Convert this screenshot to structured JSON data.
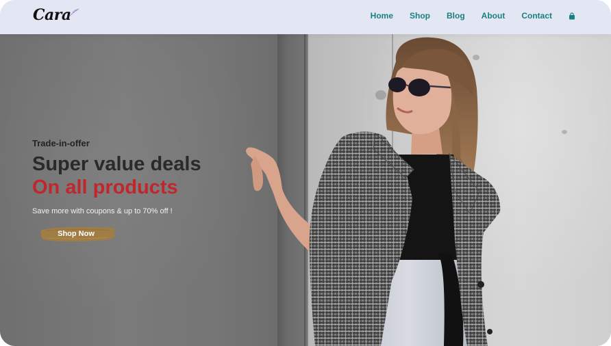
{
  "header": {
    "logo_text": "Cara",
    "nav": [
      {
        "label": "Home"
      },
      {
        "label": "Shop"
      },
      {
        "label": "Blog"
      },
      {
        "label": "About"
      },
      {
        "label": "Contact"
      }
    ],
    "cart_icon": "shopping-bag-icon",
    "nav_color": "#1a7f80",
    "background": "#e3e6f3"
  },
  "hero": {
    "subtitle": "Trade-in-offer",
    "headline_line1": "Super value deals",
    "headline_line2": "On all products",
    "tagline": "Save more with coupons & up to 70% off !",
    "cta_label": "Shop Now",
    "accent_color": "#c0272d",
    "cta_color": "#a07d45"
  }
}
